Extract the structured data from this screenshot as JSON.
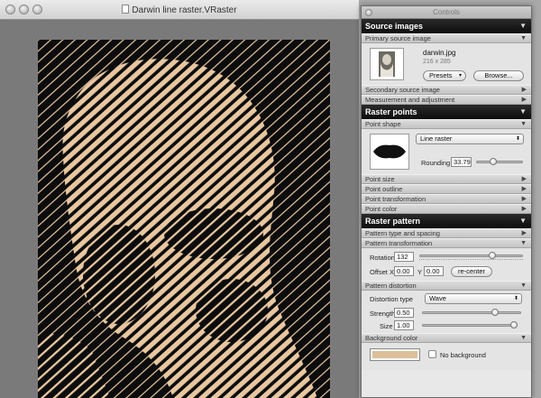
{
  "window": {
    "title": "Darwin line raster.VRaster"
  },
  "canvas": {
    "background_color": "#0c0c0c",
    "line_color": "#e8c7a0"
  },
  "controls": {
    "title": "Controls",
    "source_images": {
      "header": "Source images",
      "primary_label": "Primary source image",
      "file_name": "darwin.jpg",
      "file_dims": "216 x 285",
      "presets_label": "Presets",
      "browse_label": "Browse...",
      "secondary_label": "Secondary source image",
      "measurement_label": "Measurement and adjustment"
    },
    "raster_points": {
      "header": "Raster points",
      "point_shape_label": "Point shape",
      "shape_select": "Line raster",
      "rounding_label": "Rounding",
      "rounding_value": "33.79",
      "rounding_fraction": 0.34,
      "point_size_label": "Point size",
      "point_outline_label": "Point outline",
      "point_transformation_label": "Point transformation",
      "point_color_label": "Point color"
    },
    "raster_pattern": {
      "header": "Raster pattern",
      "type_spacing_label": "Pattern type and spacing",
      "transformation_label": "Pattern transformation",
      "rotation_label": "Rotation",
      "rotation_value": "132",
      "rotation_fraction": 0.72,
      "offset_x_label": "Offset X",
      "offset_x_value": "0.00",
      "offset_y_label": "Y",
      "offset_y_value": "0.00",
      "recenter_label": "re-center",
      "distortion_label": "Pattern distortion",
      "distortion_type_label": "Distortion type",
      "distortion_type_value": "Wave",
      "strength_label": "Strength",
      "strength_value": "0.50",
      "strength_fraction": 0.75,
      "size_label": "Size",
      "size_value": "1.00",
      "size_fraction": 1.0,
      "background_color_label": "Background color",
      "background_swatch": "#dcc09a",
      "no_background_label": "No background"
    }
  }
}
